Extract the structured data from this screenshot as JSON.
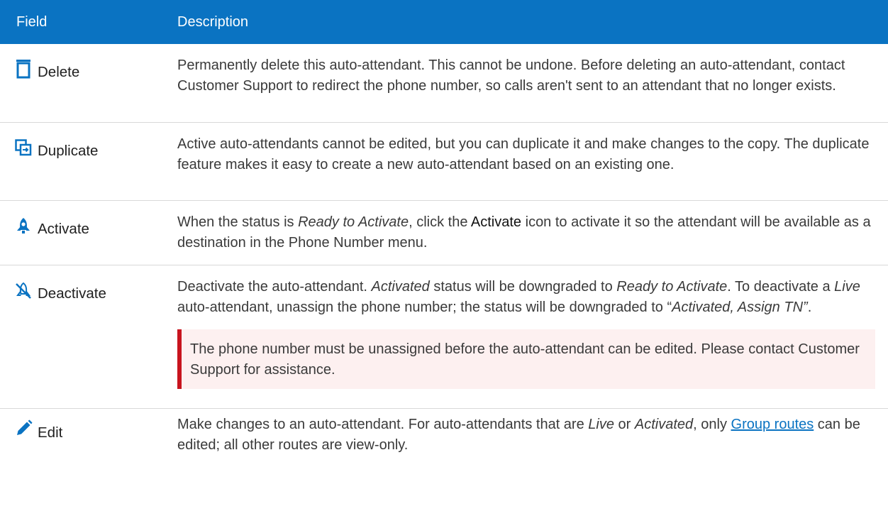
{
  "header": {
    "field_label": "Field",
    "description_label": "Description"
  },
  "colors": {
    "header_bg": "#0a73c2",
    "icon_blue": "#0a73c2",
    "note_bar": "#c8141e",
    "note_bg": "#fdf0f0",
    "link": "#0a73c2"
  },
  "rows": [
    {
      "icon": "trash-icon",
      "field": "Delete",
      "description": "Permanently delete this auto-attendant. This cannot be undone. Before deleting an auto-attendant, contact Customer Support to redirect the phone number, so calls aren't sent to an attendant that no longer exists."
    },
    {
      "icon": "duplicate-icon",
      "field": "Duplicate",
      "description": "Active auto-attendants cannot be edited, but you can duplicate it and make changes to the copy. The duplicate feature makes it easy to create a new auto-attendant based on an existing one."
    },
    {
      "icon": "rocket-icon",
      "field": "Activate",
      "desc_p1": "When the status is ",
      "desc_i1": "Ready to Activate",
      "desc_p2": ", click the ",
      "desc_b1": "Activate",
      "desc_p3": " icon to activate it so the attendant will be available as a destination in the Phone Number menu."
    },
    {
      "icon": "rocket-off-icon",
      "field": "Deactivate",
      "desc_p1": "Deactivate the auto-attendant. ",
      "desc_i1": "Activated",
      "desc_p2": " status will be downgraded to ",
      "desc_i2": "Ready to Activate",
      "desc_p3": ". To deactivate a ",
      "desc_i3": "Live",
      "desc_p4": " auto-attendant, unassign the phone number; the status will be downgraded to “",
      "desc_i4": "Activated, Assign TN”",
      "desc_p5": ".",
      "note": "The phone number must be unassigned before the auto-attendant can be edited. Please contact Customer Support for assistance."
    },
    {
      "icon": "pencil-icon",
      "field": "Edit",
      "desc_p1": "Make changes to an auto-attendant. For auto-attendants that are ",
      "desc_i1": "Live",
      "desc_p2": " or ",
      "desc_i2": "Activated",
      "desc_p3": ", only ",
      "desc_link": "Group routes",
      "desc_p4": " can be edited; all other routes are view-only."
    }
  ]
}
